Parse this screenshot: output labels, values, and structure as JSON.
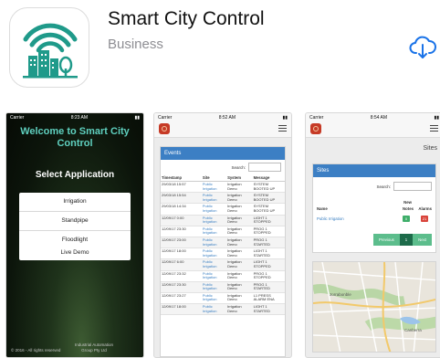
{
  "app": {
    "title": "Smart City Control",
    "category": "Business"
  },
  "screenshot1": {
    "status": {
      "carrier": "Carrier",
      "time": "8:23 AM"
    },
    "welcome": "Welcome to Smart City Control",
    "select_heading": "Select Application",
    "menu": [
      "Irrigation",
      "Standpipe",
      "Floodlight"
    ],
    "live_demo": "Live Demo",
    "footer_left": "© 2016 - All rights reserved",
    "footer_right": "Industrial Automation Group Pty Ltd"
  },
  "screenshot2": {
    "status": {
      "carrier": "Carrier",
      "time": "8:52 AM"
    },
    "panel_title": "Events",
    "search_label": "Search:",
    "columns": [
      "Timestamp",
      "Site",
      "System",
      "Message"
    ],
    "rows": [
      [
        "29/03/18 15:57",
        "Public Irrigation",
        "Irrigation Demo",
        "SYSTEM BOOTED UP"
      ],
      [
        "29/03/18 15:54",
        "Public Irrigation",
        "Irrigation Demo",
        "SYSTEM BOOTED UP"
      ],
      [
        "29/03/18 14:34",
        "Public Irrigation",
        "Irrigation Demo",
        "SYSTEM BOOTED UP"
      ],
      [
        "12/09/17 0:00",
        "Public Irrigation",
        "Irrigation Demo",
        "LIGHT 1 STOPPED"
      ],
      [
        "12/09/17 23:30",
        "Public Irrigation",
        "Irrigation Demo",
        "PROG 1 STOPPED"
      ],
      [
        "12/09/17 23:00",
        "Public Irrigation",
        "Irrigation Demo",
        "PROG 1 STARTED"
      ],
      [
        "12/09/17 18:00",
        "Public Irrigation",
        "Irrigation Demo",
        "LIGHT 1 STARTED"
      ],
      [
        "12/09/17 6:00",
        "Public Irrigation",
        "Irrigation Demo",
        "LIGHT 1 STOPPED"
      ],
      [
        "12/09/17 23:32",
        "Public Irrigation",
        "Irrigation Demo",
        "PROG 1 STOPPED"
      ],
      [
        "12/09/17 23:30",
        "Public Irrigation",
        "Irrigation Demo",
        "PROG 1 STARTED"
      ],
      [
        "12/09/17 23:27",
        "Public Irrigation",
        "Irrigation Demo",
        "L1 PRESS ALARM ENA"
      ],
      [
        "12/09/17 18:00",
        "Public Irrigation",
        "Irrigation Demo",
        "LIGHT 1 STARTED"
      ]
    ]
  },
  "screenshot3": {
    "status": {
      "carrier": "Carrier",
      "time": "8:54 AM"
    },
    "page_heading": "Sites",
    "panel_title": "Sites",
    "search_label": "Search:",
    "col_name": "Name",
    "col_new": "New",
    "col_notes": "Notes",
    "col_alarms": "Alarms",
    "site_name": "Public Irrigation",
    "notes_count": "0",
    "alarms_count": "21",
    "pager": [
      "Previous",
      "1",
      "Next"
    ],
    "map_labels": [
      "Jorrabonble",
      "Canberra"
    ],
    "colors": {
      "primary": "#3c7fc4",
      "notes_badge": "#3fae6a",
      "alarms_badge": "#d9443b",
      "pager": "#5cbd8c"
    }
  }
}
